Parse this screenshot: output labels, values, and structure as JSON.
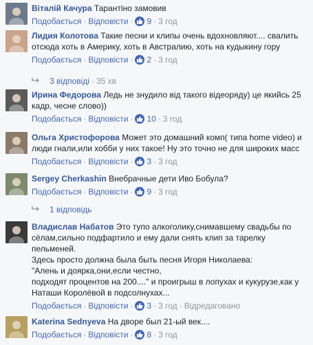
{
  "action_labels": {
    "like": "Подобається",
    "reply": "Відповісти",
    "edited": "Відредаговано"
  },
  "comments": [
    {
      "author": "Віталій Качура",
      "text": [
        "Тарантіно замовив"
      ],
      "likes": "9",
      "time": "3 год",
      "avatar_color": "#6d7a8a"
    },
    {
      "author": "Лидия Колотова",
      "text": [
        "Такие песни и клипы очень вдохновляют.... свалить",
        "отсюда хоть в Америку, хоть в Австралию, хоть на кудыкину гору"
      ],
      "likes": "2",
      "time": "3 год",
      "avatar_color": "#c9a38a"
    },
    {
      "author": "Ирина Федорова",
      "text": [
        "Ледь не знудило від такого відеоряду) це якийсь 25",
        "кадр, чесне слово))"
      ],
      "likes": "10",
      "time": "3 год",
      "avatar_color": "#5a5a5a"
    },
    {
      "author": "Ольга Христофорова",
      "text": [
        "Может это домашний комп( типа home video) и",
        "люди гнали,или хобби у них такое! Ну это точно не для широких масс"
      ],
      "likes": "3",
      "time": "3 год",
      "avatar_color": "#8a7a6a"
    },
    {
      "author": "Sergey Cherkashin",
      "text": [
        "Внебрачные дети Иво Бобула?"
      ],
      "likes": "9",
      "time": "3 год",
      "avatar_color": "#7d8a6d"
    },
    {
      "author": "Владислав Набатов",
      "text": [
        "Это тупо алкоголику,снимавшему свадьбы по",
        "сёлам,сильно подфартило и ему дали снять клип за тарелку",
        "пельменей.",
        "Здесь просто должна была быть песня Игоря Николаева:",
        "\"Алень и доярка,они,если честно,",
        "подходят процентов на 200....\" и проигрыш в лопухах и кукурузе,как у",
        "Наташи Королёвой в подсолнухах..."
      ],
      "likes": "3",
      "time": "3 год",
      "edited": true,
      "avatar_color": "#3a3a3a"
    },
    {
      "author": "Katerina Sednyeva",
      "text": [
        "На дворе был 21-ый век...."
      ],
      "likes": "8",
      "time": "3 год",
      "avatar_color": "#b8a060"
    }
  ],
  "reply_threads": [
    {
      "count_label": "3 відповіді",
      "time": "35 хв"
    },
    {
      "count_label": "1 відповідь",
      "time": ""
    }
  ]
}
